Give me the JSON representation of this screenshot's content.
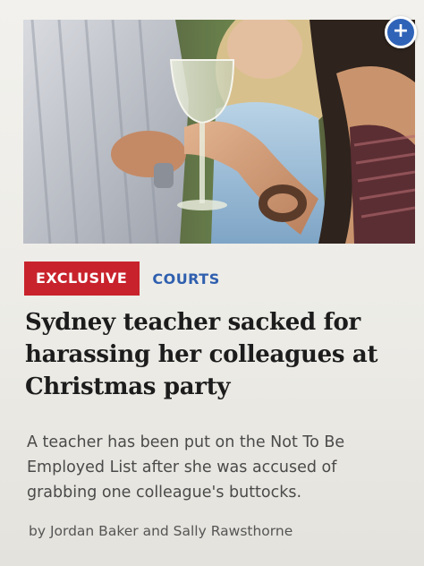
{
  "article": {
    "image_icon": "photo-party-glass",
    "add_button": {
      "icon": "plus-icon",
      "glyph": "+",
      "color": "#2f63b8"
    },
    "tags": {
      "exclusive": "EXCLUSIVE",
      "exclusive_color": "#c8232c",
      "section": "COURTS",
      "section_color": "#2f5fae"
    },
    "headline": "Sydney teacher sacked for harassing her colleagues at Christmas party",
    "summary": "A teacher has been put on the Not To Be Employed List after she was accused of grabbing one colleague's buttocks.",
    "byline": "by Jordan Baker and Sally Rawsthorne"
  }
}
